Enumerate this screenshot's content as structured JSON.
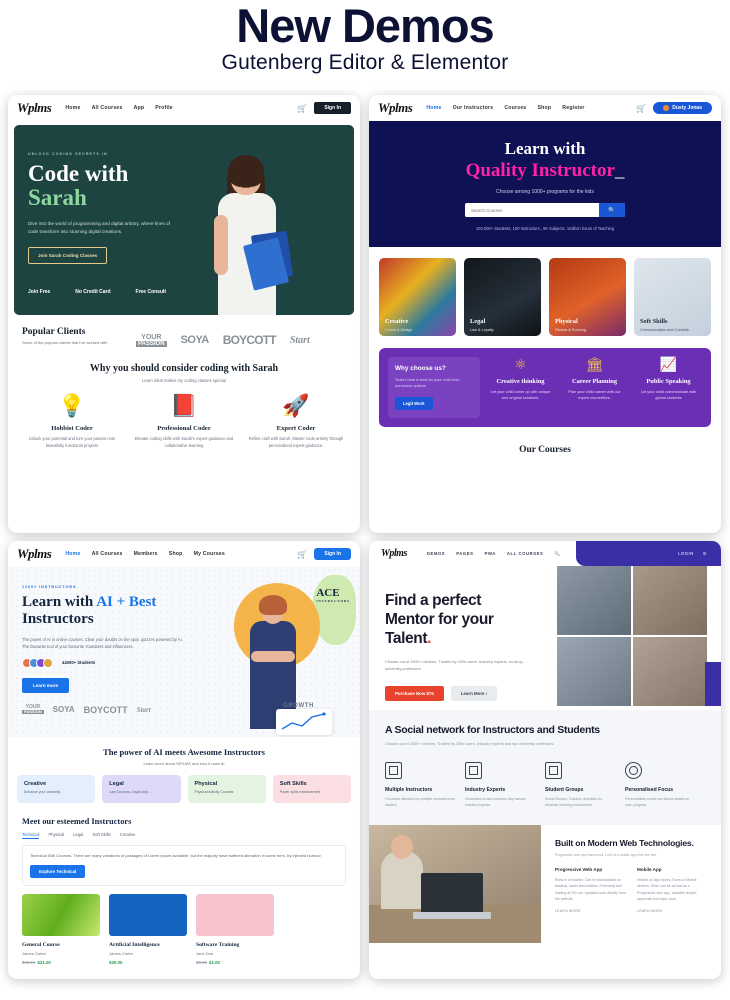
{
  "header": {
    "title": "New Demos",
    "subtitle": "Gutenberg Editor & Elementor"
  },
  "demo1": {
    "brand": "Wplms",
    "nav": [
      "Home",
      "All Courses",
      "App",
      "Profile"
    ],
    "cart_icon": "cart-icon",
    "signin": "Sign In",
    "hero": {
      "eyebrow": "UNLOCK CODING SECRETS IN",
      "title_line1": "Code with",
      "title_line2": "Sarah",
      "description": "Dive into the world of programming and digital artistry, where lines of code transform into stunning digital creations.",
      "cta": "Join Sarah Coding Classes",
      "meta": [
        "Join Free",
        "No Credit Card",
        "Free Consult"
      ]
    },
    "clients": {
      "title": "Popular Clients",
      "subtitle": "Some of the popular clients that i've worked with",
      "logos": [
        {
          "pre": "FIND",
          "top": "YOUR",
          "bottom": "PASSION"
        },
        {
          "text": "SOYA",
          "sub": "MILK  PREMIUM"
        },
        {
          "text": "BOYCOTT"
        },
        {
          "text": "Start"
        }
      ]
    },
    "why": {
      "title": "Why you should consider coding with Sarah",
      "subtitle": "Learn what makes my coding classes special",
      "features": [
        {
          "icon": "💡",
          "icon_name": "lightbulb-icon",
          "title": "Hobbist Coder",
          "desc": "Unlock your potential and turn your passion into beautifully functional projects"
        },
        {
          "icon": "📕",
          "icon_name": "book-icon",
          "title": "Professional Coder",
          "desc": "Elevate coding skills with Sarah's expert guidance and collaborative learning"
        },
        {
          "icon": "🚀",
          "icon_name": "rocket-icon",
          "title": "Expert Coder",
          "desc": "Refine craft with Sarah. Master code artistry through personalized expert guidance."
        }
      ]
    }
  },
  "demo2": {
    "brand": "Wplms",
    "nav": [
      "Home",
      "Our Instructors",
      "Courses",
      "Shop",
      "Register"
    ],
    "cart_icon": "cart-icon",
    "user": "Dusty Jonas",
    "hero": {
      "title_line1": "Learn with",
      "title_line2": "Quality Instructor",
      "cursor": "_",
      "subtitle": "Choose among 1000+ programs for the kids",
      "search_placeholder": "Search Courses",
      "search_value": "",
      "search_icon": "search-icon",
      "stats": "100,000+ Students, 100 Instructors , 96 Subjects, 1million hours of Teaching"
    },
    "categories": [
      {
        "title": "Creative",
        "sub": "Colors & Design"
      },
      {
        "title": "Legal",
        "sub": "Law & Loyalty"
      },
      {
        "title": "Physical",
        "sub": "Fitness & Running"
      },
      {
        "title": "Soft Skills",
        "sub": "Communication and Condide"
      }
    ],
    "why": {
      "card_title": "Why choose us?",
      "card_desc": "Select what is best for your child from numerous options",
      "card_btn": "Legit Work",
      "features": [
        {
          "icon": "⚛",
          "icon_name": "atom-icon",
          "title": "Creative thinking",
          "desc": "Let your child come up with unique and original solutions."
        },
        {
          "icon": "🏛",
          "icon_name": "bank-icon",
          "title": "Career Planning",
          "desc": "Plan your child career with our expert counsellors."
        },
        {
          "icon": "📈",
          "icon_name": "chart-icon",
          "title": "Public Speaking",
          "desc": "Let your child communicate with global students"
        }
      ]
    },
    "courses_heading": "Our Courses"
  },
  "demo3": {
    "brand": "Wplms",
    "nav": [
      "Home",
      "All Courses",
      "Members",
      "Shop",
      "My Courses"
    ],
    "cart_icon": "cart-icon",
    "signin": "Sign In",
    "hero": {
      "eyebrow": "1200+ INSTRUCTORS",
      "title_pre": "Learn with ",
      "title_accent": "AI + Best",
      "title_post": "Instructors",
      "description": "The power of AI in online courses. Clear your doubts on the spot, quizzes powered by AI. The favourite tool of your favourite Youtubers and influencers.",
      "students": "44000+ Students",
      "btn": "Learn more",
      "badge_title": "ACE",
      "badge_sub": "INSTRUCTORS",
      "growth": "GROWTH"
    },
    "ai": {
      "title": "The power of AI meets Awesome Instructors",
      "subtitle": "Learn more about WPLMS and how it uses AI",
      "pills": [
        {
          "title": "Creative",
          "desc": "Enhance your creativity"
        },
        {
          "title": "Legal",
          "desc": "Law Courses, Legal duty ..."
        },
        {
          "title": "Physical",
          "desc": "Physical Activity Courses"
        },
        {
          "title": "Soft Skills",
          "desc": "Power skills enhancement"
        }
      ]
    },
    "meet": {
      "title": "Meet our esteemed Instructors",
      "tabs": [
        "Technical",
        "Physical",
        "Legal",
        "Soft Skills",
        "Creative"
      ],
      "box_desc": "Technical Skill Courses. There are many variations of passages of Lorem Ipsum available, but the majority have suffered alteration in some form, by injected humour.",
      "box_btn": "Explore Technical",
      "courses": [
        {
          "title": "General Course",
          "author": "James Carter",
          "old_price": "$49.99",
          "price": "$21.00"
        },
        {
          "title": "Artificial Intelligence",
          "author": "James Carter",
          "old_price": "",
          "price": "$30.00"
        },
        {
          "title": "Software Training",
          "author": "Jane Doe",
          "old_price": "$9.99",
          "price": "$1.00"
        }
      ]
    }
  },
  "demo4": {
    "brand": "Wplms",
    "nav": [
      "DEMOS",
      "PAGES",
      "PWA",
      "ALL COURSES"
    ],
    "search_icon": "search-icon",
    "login": "LOGIN",
    "menu_icon": "menu-icon",
    "hero": {
      "title_line1": "Find a perfect",
      "title_line2": "Mentor for your",
      "title_line3": "Talent",
      "dot": ".",
      "description": "Choose out of 2500+ mentors. Trusted by 250k users. Industry experts, ex-shop, university professors.",
      "btn_primary": "Purchase Now $75",
      "btn_secondary": "Learn More ›"
    },
    "social": {
      "title": "A Social network for Instructors and Students",
      "subtitle": "Choose out of 2500+ mentors. Trusted by 250k users. Industry experts and top university professors.",
      "features": [
        {
          "icon_name": "instructors-icon",
          "title": "Multiple Instructors",
          "desc": "Focussed attention by multiple instructors per student."
        },
        {
          "icon_name": "experts-icon",
          "title": "Industry Experts",
          "desc": "Consulted on and common day various Industry experts."
        },
        {
          "icon_name": "groups-icon",
          "title": "Student Groups",
          "desc": "Social Groups, Classes, Activities for wholistic learning environment"
        },
        {
          "icon_name": "focus-icon",
          "title": "Personalised Focus",
          "desc": "Personalised course curriculum based on user progress."
        }
      ]
    },
    "tech": {
      "title": "Built on Modern Web Technologies.",
      "subtitle": "Progressive web app framework. Lot's of a mobile app from the site.",
      "columns": [
        {
          "title": "Progressive Web App",
          "desc": "Runs in a browser. Can be downloaded on desktop, tablet and mobiles. Extremely fast loading at 200 ms. Updates work directly from the website.",
          "link": "LEARN MORE"
        },
        {
          "title": "Mobile App",
          "desc": "Hosted on App stores. Runs on Mobile devices. Slow, can be as fast as a Progressive web app. Updates require approvals from App store.",
          "link": "LEARN MORE"
        }
      ]
    }
  }
}
